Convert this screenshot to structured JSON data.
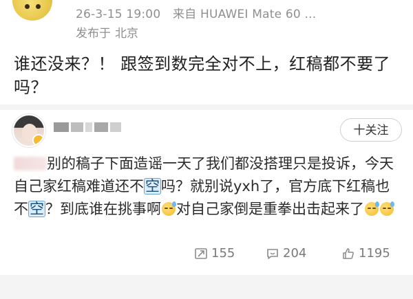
{
  "post": {
    "timestamp": "26-3-15 19:00",
    "source": "来自 HUAWEI Mate 60 ...",
    "location_label": "发布于",
    "location": "北京",
    "text": "谁还没来？！ 跟签到数完全对不上，红稿都不要了吗？"
  },
  "reply": {
    "follow_label": "十关注",
    "text_part1": "别的稿子下面造谣一天了我们都没搭理只是投诉，今天自己家红稿难道还不",
    "kong": "空",
    "text_part2": "吗？就别说yxh了，官方底下红稿也不",
    "text_part3": "？到底谁在挑事啊",
    "text_part4": "对自己家倒是重拳出击起来了",
    "actions": {
      "reposts": "155",
      "comments": "204",
      "likes": "1195"
    }
  },
  "icons": [
    "avatar",
    "vip-badge-icon",
    "repost-icon",
    "comment-icon",
    "like-icon",
    "sweat-smile-emoji"
  ],
  "colors": {
    "background": "#f4f4f4",
    "card": "#ffffff",
    "meta_text": "#8f8f8f",
    "body_text": "#2a2a2a"
  }
}
